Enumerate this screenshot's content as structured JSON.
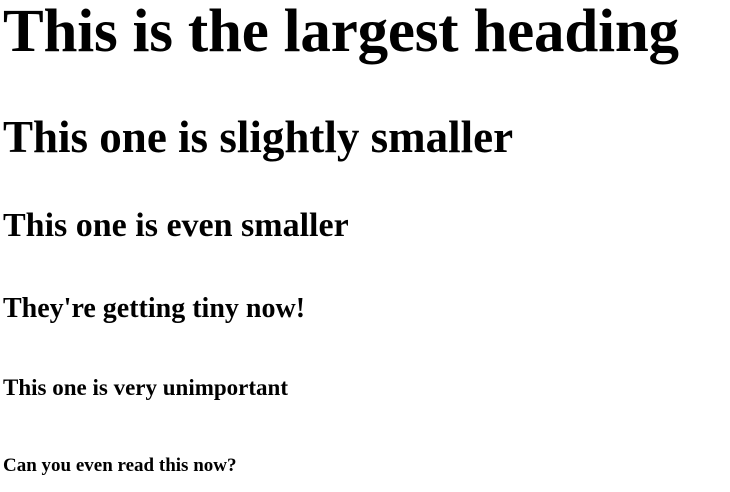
{
  "headings": [
    {
      "level": "h1",
      "text": "This is the largest heading"
    },
    {
      "level": "h2",
      "text": "This one is slightly smaller"
    },
    {
      "level": "h3",
      "text": "This one is even smaller"
    },
    {
      "level": "h4",
      "text": "They're getting tiny now!"
    },
    {
      "level": "h5",
      "text": "This one is very unimportant"
    },
    {
      "level": "h6",
      "text": "Can you even read this now?"
    }
  ]
}
